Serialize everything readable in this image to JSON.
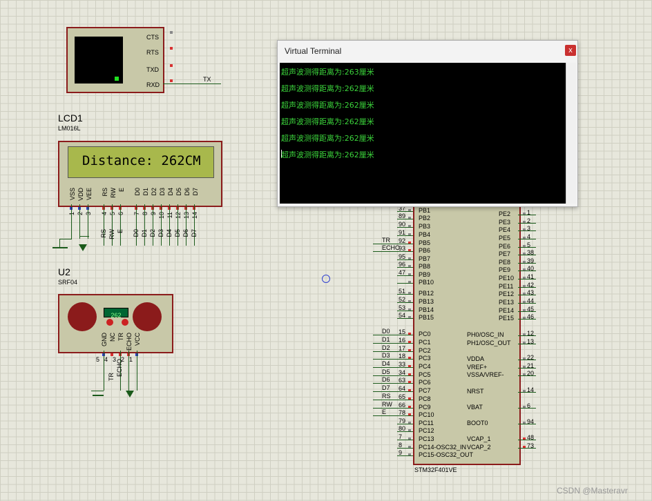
{
  "uart_module": {
    "pins": [
      "CTS",
      "RTS",
      "TXD",
      "RXD"
    ],
    "net_tx": "TX"
  },
  "lcd": {
    "ref": "LCD1",
    "part": "LM016L",
    "display": "Distance: 262CM",
    "pins": [
      "VSS",
      "VDD",
      "VEE",
      "RS",
      "RW",
      "E",
      "D0",
      "D1",
      "D2",
      "D3",
      "D4",
      "D5",
      "D6",
      "D7"
    ],
    "pin_numbers": [
      "1",
      "2",
      "3",
      "4",
      "5",
      "6",
      "7",
      "8",
      "9",
      "10",
      "11",
      "12",
      "13",
      "14"
    ],
    "nets": [
      "RS",
      "RW",
      "E",
      "D0",
      "D1",
      "D2",
      "D3",
      "D4",
      "D5",
      "D6",
      "D7"
    ]
  },
  "sensor": {
    "ref": "U2",
    "part": "SRF04",
    "readout": "262",
    "pins": [
      "GND",
      "NC",
      "TR",
      "ECHO",
      "VCC"
    ],
    "pin_numbers": [
      "5",
      "4",
      "3",
      "2",
      "1"
    ],
    "nets": [
      "TR",
      "ECHO"
    ]
  },
  "terminal": {
    "title": "Virtual Terminal",
    "close": "x",
    "lines": [
      "超声波测得距离为:263厘米",
      "超声波测得距离为:262厘米",
      "超声波测得距离为:262厘米",
      "超声波测得距离为:262厘米",
      "超声波测得距离为:262厘米",
      "超声波测得距离为:262厘米"
    ]
  },
  "mcu": {
    "part": "STM32F401VE",
    "left_pins": [
      {
        "num": "37",
        "name": "PB1"
      },
      {
        "num": "89",
        "name": "PB2"
      },
      {
        "num": "90",
        "name": "PB3"
      },
      {
        "num": "91",
        "name": "PB4"
      },
      {
        "num": "92",
        "name": "PB5"
      },
      {
        "num": "93",
        "name": "PB6"
      },
      {
        "num": "95",
        "name": "PB7"
      },
      {
        "num": "96",
        "name": "PB8"
      },
      {
        "num": "47",
        "name": "PB9"
      },
      {
        "num": "",
        "name": "PB10"
      },
      {
        "num": "51",
        "name": "PB12"
      },
      {
        "num": "52",
        "name": "PB13"
      },
      {
        "num": "53",
        "name": "PB14"
      },
      {
        "num": "54",
        "name": "PB15"
      },
      {
        "num": "15",
        "name": "PC0"
      },
      {
        "num": "16",
        "name": "PC1"
      },
      {
        "num": "17",
        "name": "PC2"
      },
      {
        "num": "18",
        "name": "PC3"
      },
      {
        "num": "33",
        "name": "PC4"
      },
      {
        "num": "34",
        "name": "PC5"
      },
      {
        "num": "63",
        "name": "PC6"
      },
      {
        "num": "64",
        "name": "PC7"
      },
      {
        "num": "65",
        "name": "PC8"
      },
      {
        "num": "66",
        "name": "PC9"
      },
      {
        "num": "78",
        "name": "PC10"
      },
      {
        "num": "79",
        "name": "PC11"
      },
      {
        "num": "80",
        "name": "PC12"
      },
      {
        "num": "7",
        "name": "PC13"
      },
      {
        "num": "8",
        "name": "PC14-OSC32_IN"
      },
      {
        "num": "9",
        "name": "PC15-OSC32_OUT"
      }
    ],
    "left_nets": [
      "TR",
      "ECHO",
      "D0",
      "D1",
      "D2",
      "D3",
      "D4",
      "D5",
      "D6",
      "D7",
      "RS",
      "RW",
      "E"
    ],
    "right_pins": [
      {
        "num": "1",
        "name": "PE2"
      },
      {
        "num": "2",
        "name": "PE3"
      },
      {
        "num": "3",
        "name": "PE4"
      },
      {
        "num": "4",
        "name": "PE5"
      },
      {
        "num": "5",
        "name": "PE6"
      },
      {
        "num": "38",
        "name": "PE7"
      },
      {
        "num": "39",
        "name": "PE8"
      },
      {
        "num": "40",
        "name": "PE9"
      },
      {
        "num": "41",
        "name": "PE10"
      },
      {
        "num": "42",
        "name": "PE11"
      },
      {
        "num": "43",
        "name": "PE12"
      },
      {
        "num": "44",
        "name": "PE13"
      },
      {
        "num": "45",
        "name": "PE14"
      },
      {
        "num": "46",
        "name": "PE15"
      },
      {
        "num": "12",
        "name": "PH0/OSC_IN"
      },
      {
        "num": "13",
        "name": "PH1/OSC_OUT"
      },
      {
        "num": "22",
        "name": "VDDA"
      },
      {
        "num": "21",
        "name": "VREF+"
      },
      {
        "num": "20",
        "name": "VSSA/VREF-"
      },
      {
        "num": "14",
        "name": "NRST"
      },
      {
        "num": "6",
        "name": "VBAT"
      },
      {
        "num": "94",
        "name": "BOOT0"
      },
      {
        "num": "48",
        "name": "VCAP_1"
      },
      {
        "num": "73",
        "name": "VCAP_2"
      }
    ]
  },
  "watermark": "CSDN @Masteravr"
}
